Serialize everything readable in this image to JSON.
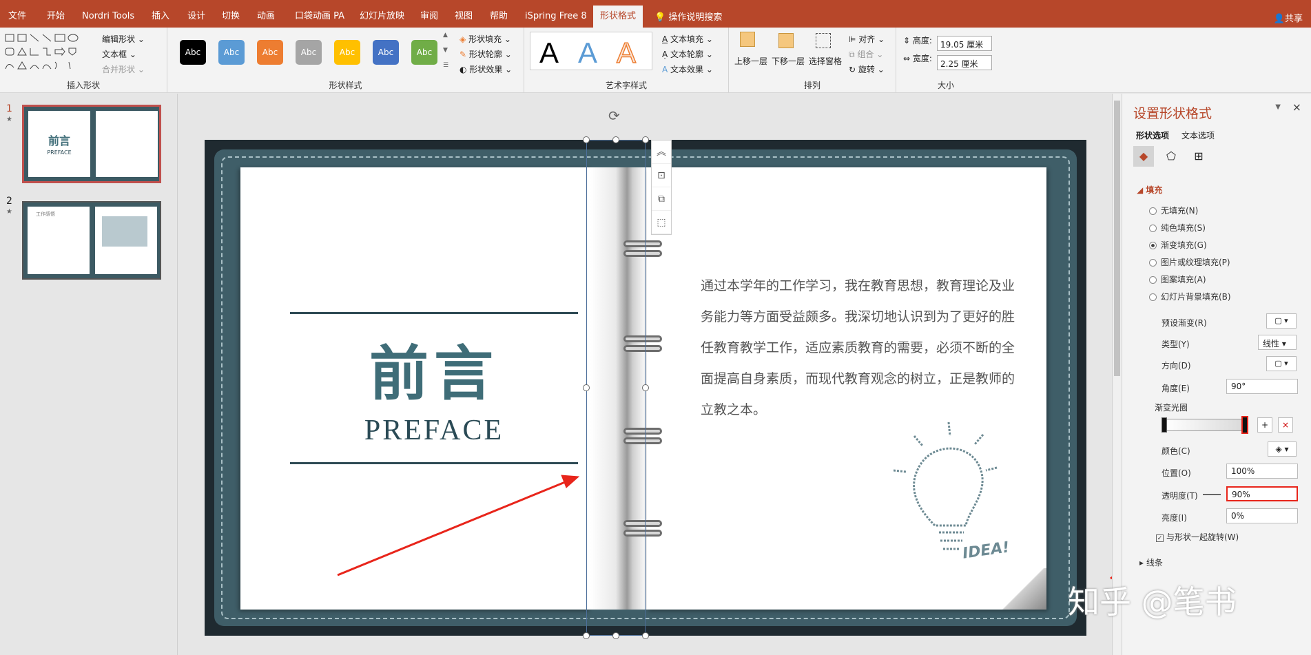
{
  "menubar": {
    "items": [
      "文件",
      "开始",
      "Nordri Tools",
      "插入",
      "设计",
      "切换",
      "动画",
      "口袋动画 PA",
      "幻灯片放映",
      "审阅",
      "视图",
      "帮助",
      "iSpring Free 8",
      "形状格式"
    ],
    "active": "形状格式",
    "search_hint": "操作说明搜索",
    "share": "共享"
  },
  "ribbon": {
    "insert_shapes": {
      "label": "插入形状",
      "edit_shape": "编辑形状",
      "textbox": "文本框",
      "merge": "合并形状"
    },
    "shape_styles": {
      "label": "形状样式",
      "presets": [
        "Abc",
        "Abc",
        "Abc",
        "Abc",
        "Abc",
        "Abc",
        "Abc"
      ],
      "fill": "形状填充",
      "outline": "形状轮廓",
      "effects": "形状效果"
    },
    "wordart": {
      "label": "艺术字样式",
      "letters": [
        "A",
        "A",
        "A"
      ],
      "text_fill": "文本填充",
      "text_outline": "文本轮廓",
      "text_effects": "文本效果"
    },
    "arrange": {
      "label": "排列",
      "bring_forward": "上移一层",
      "send_backward": "下移一层",
      "selection_pane": "选择窗格",
      "align": "对齐",
      "group": "组合",
      "rotate": "旋转"
    },
    "size": {
      "label": "大小",
      "height_label": "高度:",
      "height": "19.05 厘米",
      "width_label": "宽度:",
      "width": "2.25 厘米"
    }
  },
  "thumbnails": [
    {
      "num": "1",
      "star": "★",
      "title": "前言",
      "sub": "PREFACE"
    },
    {
      "num": "2",
      "star": "★",
      "title": "工作感悟"
    }
  ],
  "slide": {
    "title_cn": "前言",
    "title_en": "PREFACE",
    "body": "通过本学年的工作学习，我在教育思想，教育理论及业务能力等方面受益颇多。我深切地认识到为了更好的胜任教育教学工作，适应素质教育的需要，必须不断的全面提高自身素质，而现代教育观念的树立，正是教师的立教之本。",
    "idea": "IDEA!"
  },
  "panel": {
    "title": "设置形状格式",
    "tabs": [
      "形状选项",
      "文本选项"
    ],
    "fill_header": "填充",
    "fill_options": [
      "无填充(N)",
      "纯色填充(S)",
      "渐变填充(G)",
      "图片或纹理填充(P)",
      "图案填充(A)",
      "幻灯片背景填充(B)"
    ],
    "selected_fill": "渐变填充(G)",
    "preset_label": "预设渐变(R)",
    "type_label": "类型(Y)",
    "type_value": "线性",
    "direction_label": "方向(D)",
    "angle_label": "角度(E)",
    "angle_value": "90°",
    "stops_label": "渐变光圈",
    "color_label": "颜色(C)",
    "position_label": "位置(O)",
    "position_value": "100%",
    "transparency_label": "透明度(T)",
    "transparency_value": "90%",
    "brightness_label": "亮度(I)",
    "brightness_value": "0%",
    "rotate_check": "与形状一起旋转(W)",
    "line_header": "线条"
  },
  "watermark": "知乎 @笔书",
  "colors": {
    "accent": "#b7472a",
    "leather": "#3f5e68",
    "arrow": "#e8251b"
  }
}
